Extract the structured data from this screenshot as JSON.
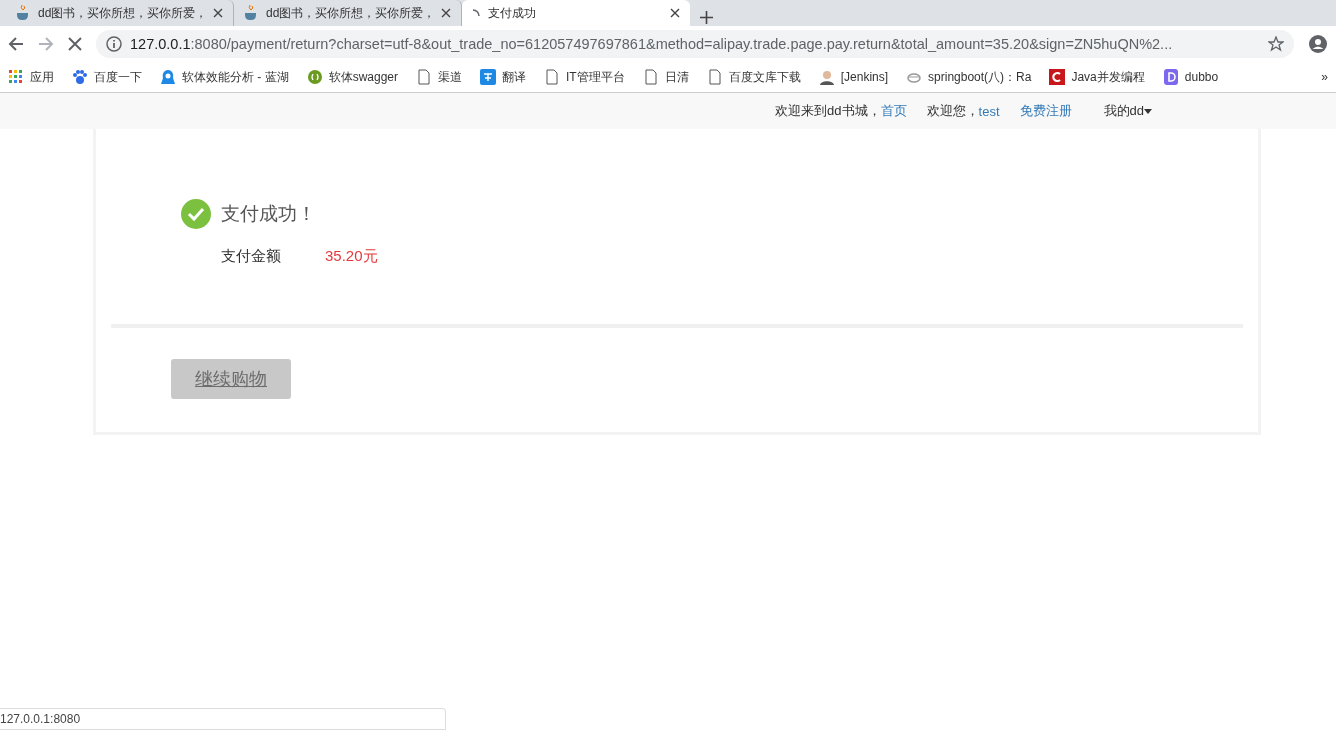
{
  "tabs": [
    {
      "title": "dd图书，买你所想，买你所爱，",
      "selected": false
    },
    {
      "title": "dd图书，买你所想，买你所爱，",
      "selected": false
    },
    {
      "title": "支付成功",
      "selected": true
    }
  ],
  "address": {
    "host": "127.0.0.1",
    "rest": ":8080/payment/return?charset=utf-8&out_trade_no=612057497697861&method=alipay.trade.page.pay.return&total_amount=35.20&sign=ZN5huQN%2..."
  },
  "bookmarks": [
    {
      "label": "应用"
    },
    {
      "label": "百度一下"
    },
    {
      "label": "软体效能分析 - 蓝湖"
    },
    {
      "label": "软体swagger"
    },
    {
      "label": "渠道"
    },
    {
      "label": "翻译"
    },
    {
      "label": "IT管理平台"
    },
    {
      "label": "日清"
    },
    {
      "label": "百度文库下载"
    },
    {
      "label": "[Jenkins]"
    },
    {
      "label": "springboot(八)：Ra"
    },
    {
      "label": "Java并发编程"
    },
    {
      "label": "dubbo"
    }
  ],
  "more_bookmarks": "»",
  "header": {
    "welcome": "欢迎来到dd书城，",
    "home_link": "首页",
    "greeting": "欢迎您，",
    "user_link": "test",
    "register_link": "免费注册",
    "menu": "我的dd"
  },
  "result": {
    "title": "支付成功！",
    "amount_label": "支付金额",
    "amount": "35.20元"
  },
  "continue_button": "继续购物",
  "status_url": "127.0.0.1:8080"
}
